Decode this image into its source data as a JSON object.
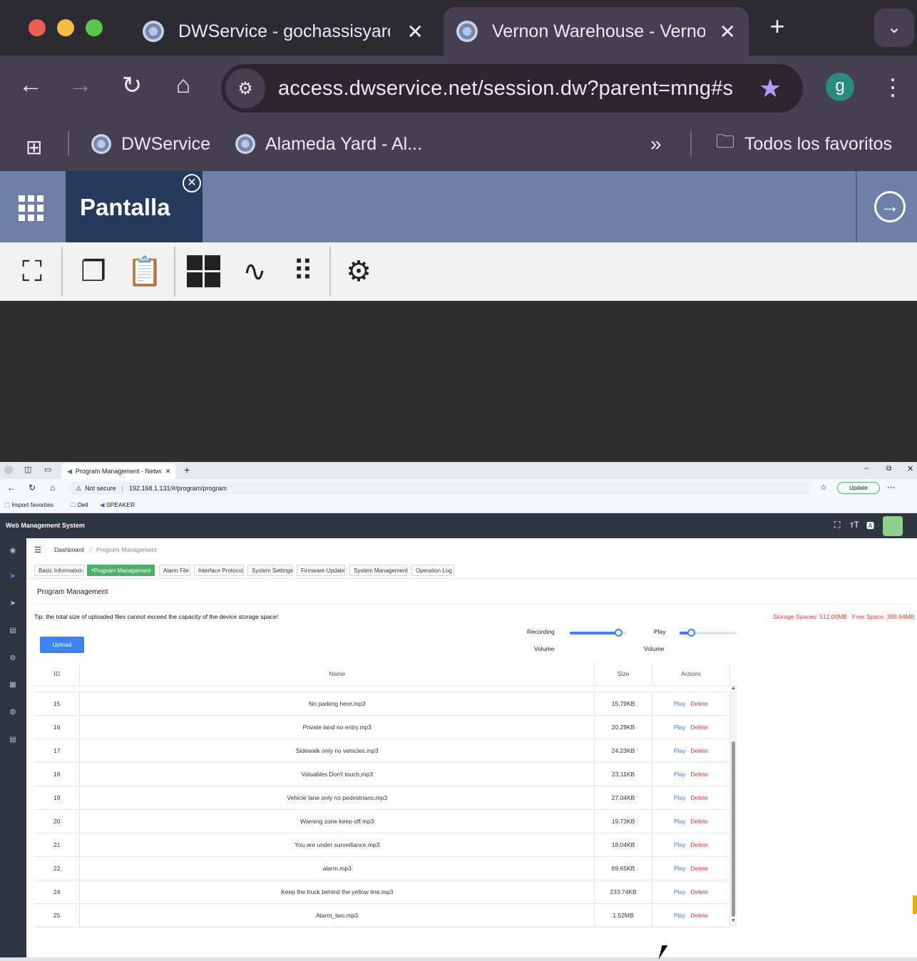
{
  "outer_browser": {
    "tabs": [
      {
        "title": "DWService - gochassisyard"
      },
      {
        "title": "Vernon Warehouse - Vernon"
      }
    ],
    "url": "access.dwservice.net/session.dw?parent=mng#s",
    "bookmarks": [
      "DWService",
      "Alameda Yard - Al...",
      "Todos los favoritos"
    ],
    "profile_initial": "g"
  },
  "dwservice": {
    "tab_label": "Pantalla"
  },
  "remote_browser": {
    "tab_title": "Program Management - Network",
    "not_secure": "Not secure",
    "url": "192.168.1.131/#/program/program",
    "update_label": "Update",
    "bookmarks": [
      "Import favorites",
      "Dell",
      "SPEAKER"
    ]
  },
  "app": {
    "title": "Web Management System",
    "breadcrumb": [
      "Dashboard",
      "Program Management"
    ],
    "tabs": [
      "Basic Information",
      "Program Management",
      "Alarm File",
      "Interface Protocol",
      "System Settings",
      "Firmware Update",
      "System Management",
      "Operation Log"
    ],
    "section_title": "Program Management",
    "tip": "Tip: the total size of uploaded files cannot exceed the capacity of the device storage space!",
    "storage": "Storage Spaces: 512.00MB",
    "free_space": "Free Space: 395.64MB",
    "upload_label": "Upload",
    "recording_label": "Recording",
    "recording_volume_label": "Volume",
    "recording_volume": 0.85,
    "play_label": "Play",
    "play_volume_label": "Volume",
    "play_volume": 0.2,
    "columns": [
      "ID",
      "Name",
      "Size",
      "Actions"
    ],
    "rows": [
      {
        "id": "15",
        "name": "No parking here.mp3",
        "size": "15.79KB"
      },
      {
        "id": "16",
        "name": "Private land no entry.mp3",
        "size": "20.29KB"
      },
      {
        "id": "17",
        "name": "Sidewalk only no vehicles.mp3",
        "size": "24.23KB"
      },
      {
        "id": "18",
        "name": "Valuables Don't touch.mp3",
        "size": "23.11KB"
      },
      {
        "id": "19",
        "name": "Vehicle lane only no pedestrians.mp3",
        "size": "27.04KB"
      },
      {
        "id": "20",
        "name": "Warning zone keep off.mp3",
        "size": "19.73KB"
      },
      {
        "id": "21",
        "name": "You are under surveillance.mp3",
        "size": "18.04KB"
      },
      {
        "id": "22",
        "name": "alarm.mp3",
        "size": "69.65KB"
      },
      {
        "id": "24",
        "name": "Keep the truck behind the yellow line.mp3",
        "size": "233.74KB"
      },
      {
        "id": "25",
        "name": "Alarm_two.mp3",
        "size": "1.52MB"
      }
    ],
    "play_action": "Play",
    "delete_action": "Delete"
  }
}
